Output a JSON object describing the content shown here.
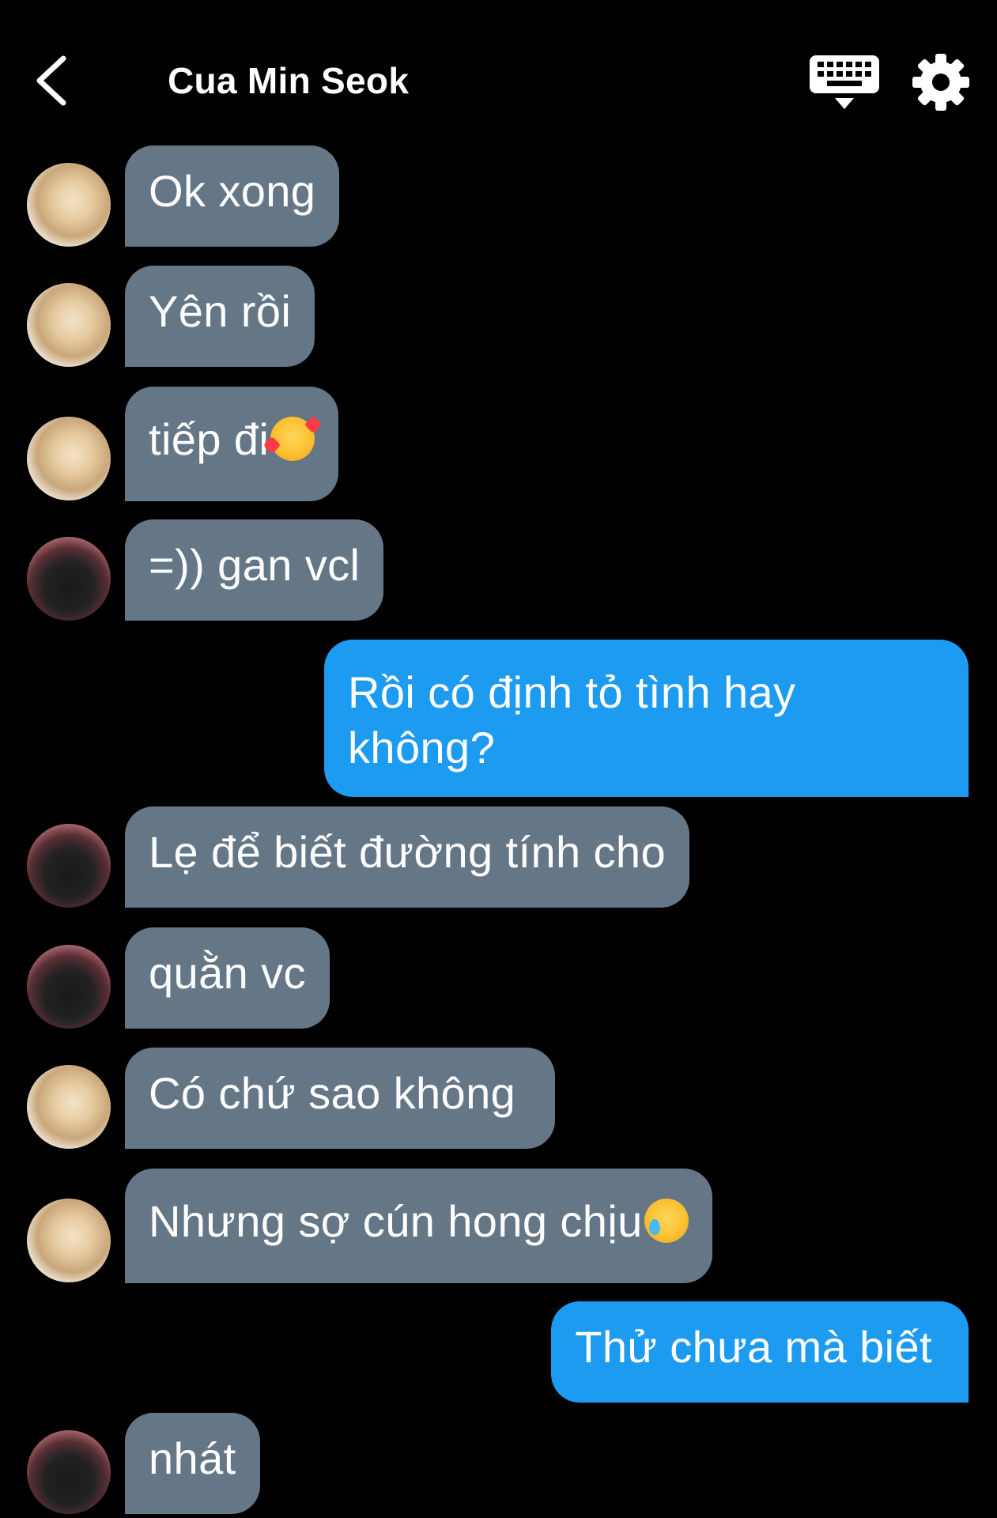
{
  "header": {
    "title": "Cua Min Seok",
    "back_icon": "chevron-left-icon",
    "keyboard_icon": "keyboard-icon",
    "settings_icon": "gear-icon"
  },
  "colors": {
    "background": "#000000",
    "incoming_bubble": "#657686",
    "outgoing_bubble": "#1d9bf0",
    "text": "#ffffff"
  },
  "messages": [
    {
      "sender": "them",
      "avatar": "dog-avatar",
      "text": "Ok xong"
    },
    {
      "sender": "them",
      "avatar": "dog-avatar",
      "text": "Yên rồi"
    },
    {
      "sender": "them",
      "avatar": "dog-avatar",
      "text": "tiếp đi",
      "emoji": "smiling-face-with-hearts"
    },
    {
      "sender": "them",
      "avatar": "boy-avatar",
      "text": "=)) gan vcl"
    },
    {
      "sender": "me",
      "text": "Rồi có định tỏ tình hay không?"
    },
    {
      "sender": "them",
      "avatar": "boy-avatar",
      "text": "Lẹ để biết đường tính cho"
    },
    {
      "sender": "them",
      "avatar": "boy-avatar",
      "text": "quằn vc"
    },
    {
      "sender": "them",
      "avatar": "dog-avatar",
      "text": "Có chứ sao không"
    },
    {
      "sender": "them",
      "avatar": "dog-avatar",
      "text": "Nhưng sợ cún hong chịu",
      "emoji": "face-holding-back-tears"
    },
    {
      "sender": "me",
      "text": "Thử chưa mà biết"
    },
    {
      "sender": "them",
      "avatar": "boy-avatar",
      "text": "nhát"
    }
  ]
}
